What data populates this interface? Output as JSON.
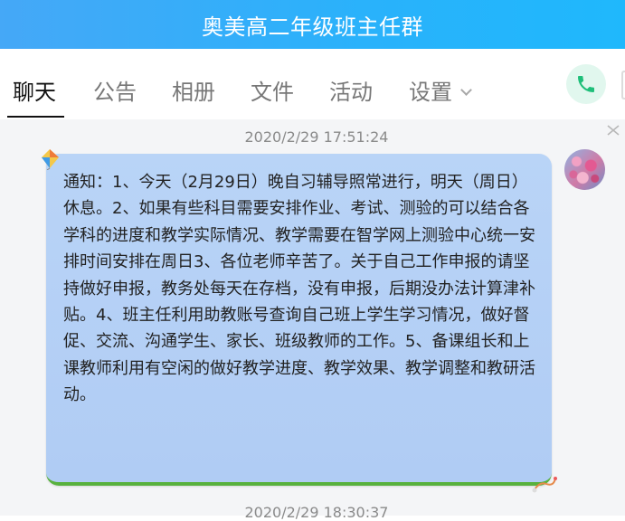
{
  "window": {
    "title": "奥美高二年级班主任群"
  },
  "tabs": [
    {
      "label": "聊天",
      "active": true
    },
    {
      "label": "公告",
      "active": false
    },
    {
      "label": "相册",
      "active": false
    },
    {
      "label": "文件",
      "active": false
    },
    {
      "label": "活动",
      "active": false
    },
    {
      "label": "设置",
      "active": false,
      "has_dropdown": true
    }
  ],
  "actions": {
    "call_icon": "phone-icon",
    "close_icon": "close-icon"
  },
  "chat": {
    "messages": [
      {
        "timestamp": "2020/2/29 17:51:24",
        "text": "通知：1、今天（2月29日）晚自习辅导照常进行，明天（周日）休息。2、如果有些科目需要安排作业、考试、测验的可以结合各学科的进度和教学实际情况、教学需要在智学网上测验中心统一安排时间安排在周日3、各位老师辛苦了。关于自己工作申报的请坚持做好申报，教务处每天在存档，没有申报，后期没办法计算津补贴。4、班主任利用助教账号查询自己班上学生学习情况，做好督促、交流、沟通学生、家长、班级教师的工作。5、备课组长和上课教师利用有空闲的做好教学进度、教学效果、教学调整和教研活动。"
      },
      {
        "timestamp": "2020/2/29 18:30:37"
      }
    ]
  },
  "colors": {
    "title_bar": "#29b2fb",
    "bubble": "#b4cff5",
    "bubble_border": "#58b13e",
    "call_button_bg": "#e1f7ee",
    "call_icon": "#1fbf7a"
  }
}
